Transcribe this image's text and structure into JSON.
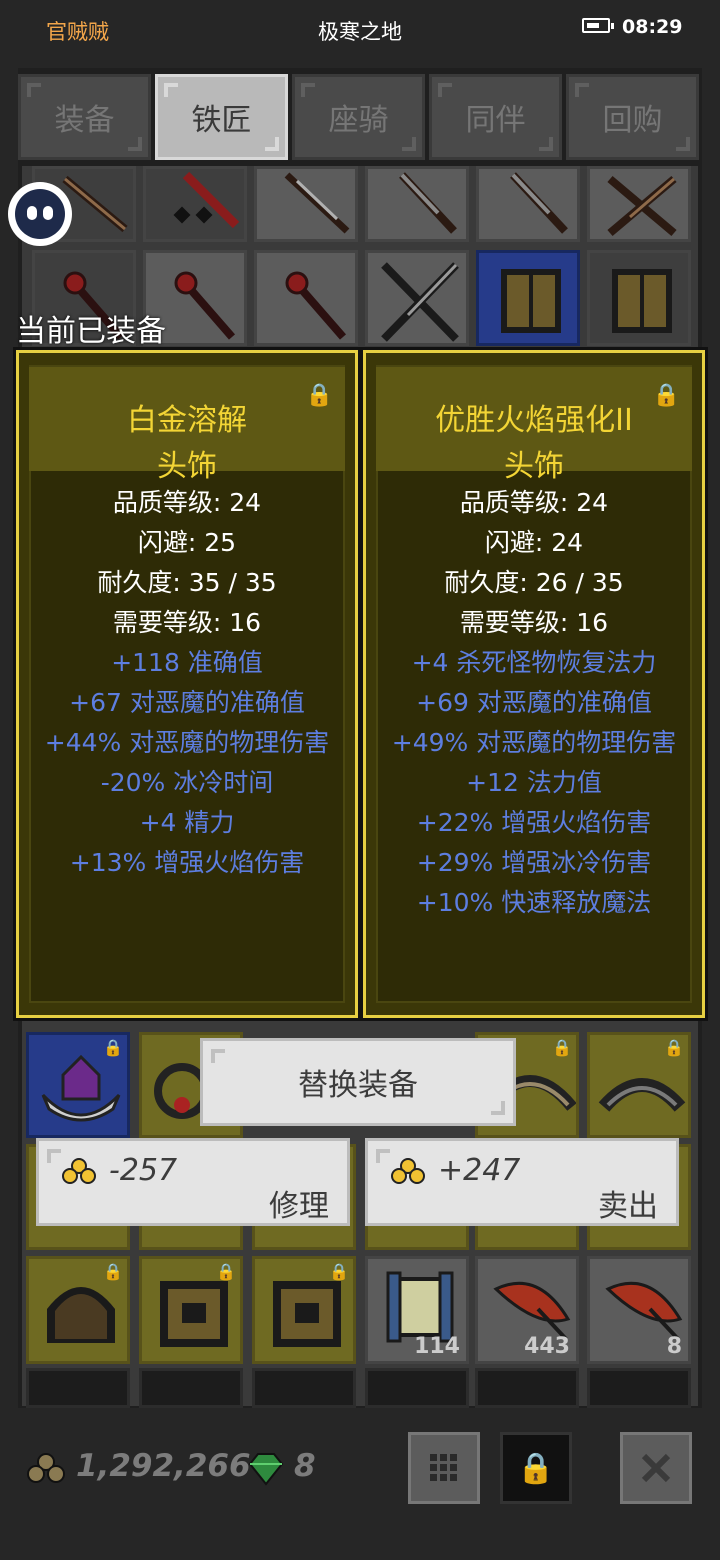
{
  "status_bar": {
    "app_name": "官贼贼",
    "title": "极寒之地",
    "time": "08:29"
  },
  "tabs": [
    {
      "label": "装备",
      "active": false
    },
    {
      "label": "铁匠",
      "active": true
    },
    {
      "label": "座骑",
      "active": false
    },
    {
      "label": "同伴",
      "active": false
    },
    {
      "label": "回购",
      "active": false
    }
  ],
  "equipped_label": "当前已装备",
  "cards": [
    {
      "name": "白金溶解",
      "slot": "头饰",
      "stats": [
        "品质等级: 24",
        "闪避: 25",
        "耐久度: 35 / 35",
        "需要等级: 16"
      ],
      "mods": [
        "+118 准确值",
        "+67 对恶魔的准确值",
        "+44% 对恶魔的物理伤害",
        "-20% 冰冷时间",
        "+4 精力",
        "+13% 增强火焰伤害"
      ]
    },
    {
      "name": "优胜火焰强化II",
      "slot": "头饰",
      "stats": [
        "品质等级: 24",
        "闪避: 24",
        "耐久度: 26 / 35",
        "需要等级: 16"
      ],
      "mods": [
        "+4 杀死怪物恢复法力",
        "+69 对恶魔的准确值",
        "+49% 对恶魔的物理伤害",
        "+12 法力值",
        "+22% 增强火焰伤害",
        "+29% 增强冰冷伤害",
        "+10% 快速释放魔法"
      ]
    }
  ],
  "buttons": {
    "replace": "替换装备",
    "repair": {
      "amount": "-257",
      "label": "修理"
    },
    "sell": {
      "amount": "+247",
      "label": "卖出"
    }
  },
  "inventory_counts": [
    "114",
    "443",
    "8"
  ],
  "currency": {
    "gold": "1,292,266",
    "gems": "8"
  },
  "colors": {
    "card_border": "#e7d042",
    "item_name": "#f3d535",
    "mod_text": "#5d7ee0"
  }
}
